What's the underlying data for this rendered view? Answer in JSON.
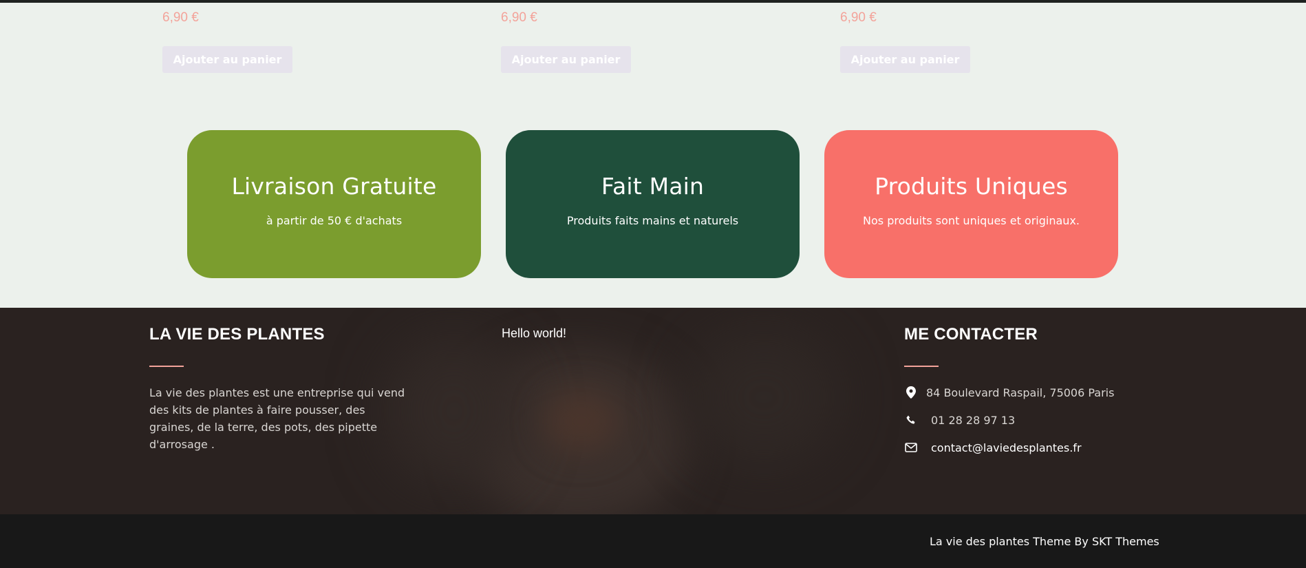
{
  "products": [
    {
      "price": "6,90 €",
      "button_label": "Ajouter au panier"
    },
    {
      "price": "6,90 €",
      "button_label": "Ajouter au panier"
    },
    {
      "price": "6,90 €",
      "button_label": "Ajouter au panier"
    }
  ],
  "features": [
    {
      "title": "Livraison Gratuite",
      "subtitle": "à partir de 50 € d'achats",
      "color": "#7b9d2e"
    },
    {
      "title": "Fait Main",
      "subtitle": "Produits faits mains et naturels",
      "color": "#1f4f3b"
    },
    {
      "title": "Produits Uniques",
      "subtitle": "Nos produits sont uniques et originaux.",
      "color": "#f87069"
    }
  ],
  "footer": {
    "about": {
      "title": "LA VIE DES PLANTES",
      "text": "La vie des plantes est une entreprise qui vend des kits de plantes à faire pousser, des graines, de la terre, des pots, des pipette d'arrosage ."
    },
    "middle": {
      "text": "Hello world!"
    },
    "contact": {
      "title": "ME CONTACTER",
      "address": "84 Boulevard Raspail, 75006 Paris",
      "phone": "01 28 28 97 13",
      "email": "contact@laviedesplantes.fr",
      "icons": [
        "map-marker-icon",
        "phone-icon",
        "envelope-icon"
      ]
    },
    "accent_color": "#f3a39a"
  },
  "bottom_bar": {
    "credit": "La vie des plantes Theme By SKT Themes"
  }
}
